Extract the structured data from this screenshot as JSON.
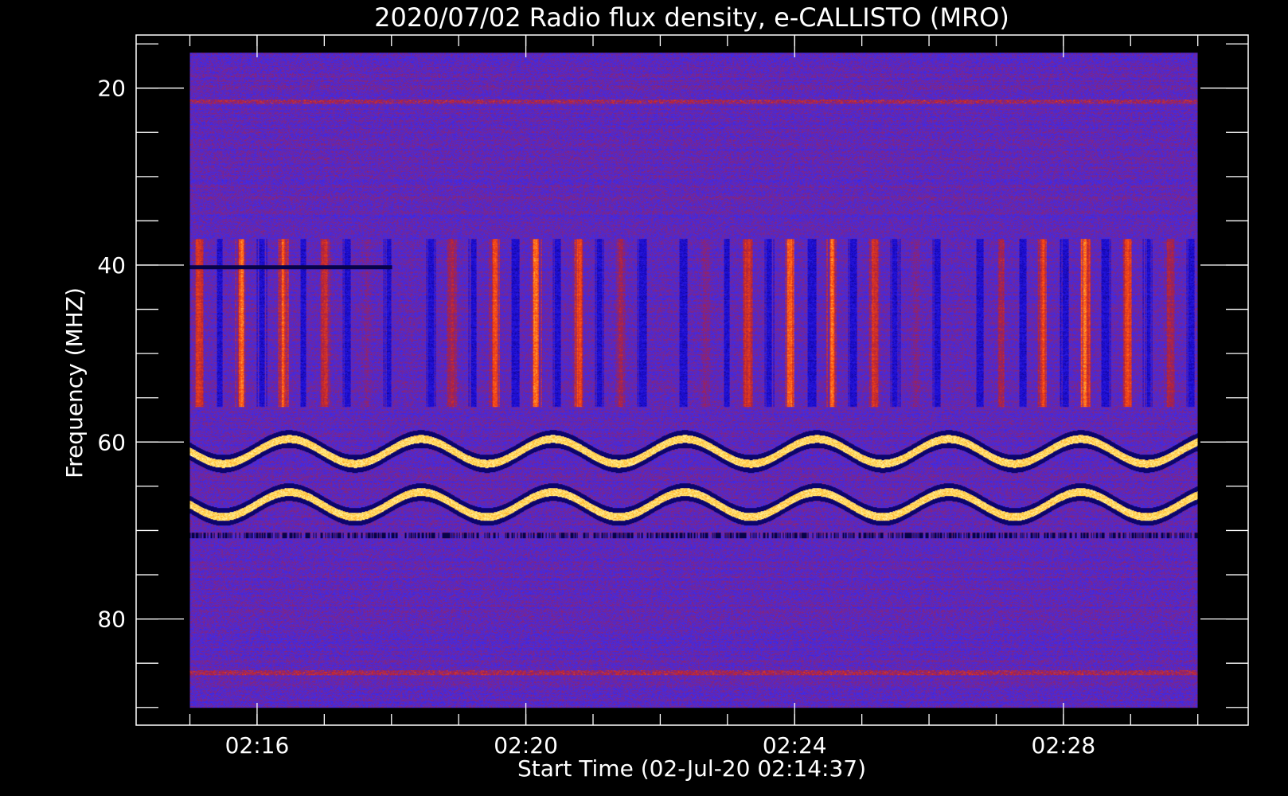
{
  "chart_data": {
    "type": "heatmap",
    "title": "2020/07/02  Radio flux density, e-CALLISTO (MRO)",
    "xlabel": "Start Time (02-Jul-20 02:14:37)",
    "ylabel": "Frequency (MHZ)",
    "x_ticks": [
      "02:16",
      "02:20",
      "02:24",
      "02:28"
    ],
    "x_tick_minutes": [
      16,
      20,
      24,
      28
    ],
    "x_minor_minutes": [
      15,
      16,
      17,
      18,
      19,
      20,
      21,
      22,
      23,
      24,
      25,
      26,
      27,
      28,
      29,
      30
    ],
    "xlim_minutes": [
      14.2,
      30.75
    ],
    "data_x_range_minutes": [
      15.0,
      30.0
    ],
    "y_ticks": [
      "20",
      "40",
      "60",
      "80"
    ],
    "y_tick_values": [
      20,
      40,
      60,
      80
    ],
    "y_minor_step": 5,
    "ylim_mhz": [
      92,
      14
    ],
    "y_inverted": true,
    "data_y_range_mhz": [
      16,
      90
    ],
    "colormap": [
      "#000010",
      "#1a0ad0",
      "#3a2cf0",
      "#b0203a",
      "#ff4a10",
      "#ffd040",
      "#ffffd0"
    ],
    "background_color": "#000000",
    "features": {
      "upper_band_mhz": [
        58,
        64
      ],
      "lower_band_mhz": [
        64,
        70
      ],
      "burst_region_mhz": [
        37,
        56
      ],
      "dark_line_mhz": [
        40.2,
        70.5
      ]
    }
  }
}
